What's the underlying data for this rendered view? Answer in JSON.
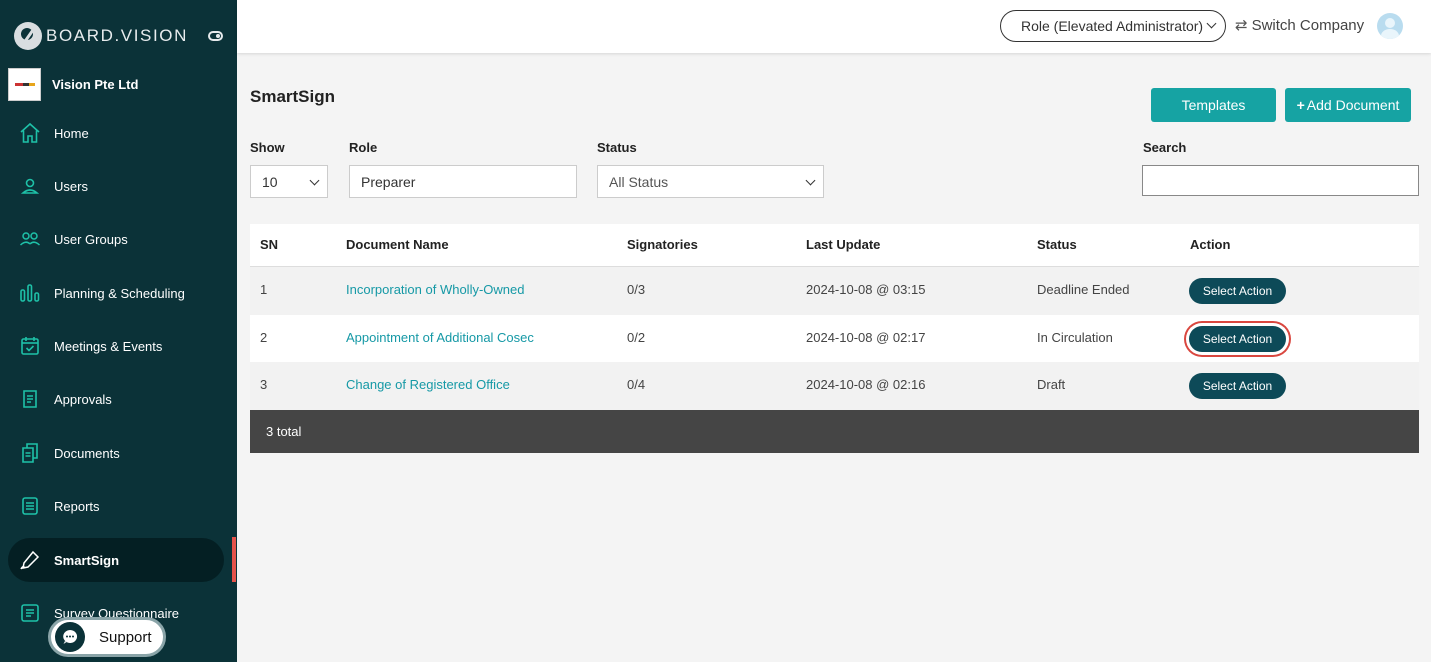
{
  "brand": {
    "name": "BOARD.VISION"
  },
  "company": {
    "name": "Vision Pte Ltd"
  },
  "sidebar": {
    "items": [
      {
        "label": "Home",
        "icon": "home-icon"
      },
      {
        "label": "Users",
        "icon": "user-icon"
      },
      {
        "label": "User Groups",
        "icon": "user-group-icon"
      },
      {
        "label": "Planning & Scheduling",
        "icon": "bar-chart-icon"
      },
      {
        "label": "Meetings & Events",
        "icon": "calendar-icon"
      },
      {
        "label": "Approvals",
        "icon": "approval-icon"
      },
      {
        "label": "Documents",
        "icon": "documents-icon"
      },
      {
        "label": "Reports",
        "icon": "report-icon"
      },
      {
        "label": "SmartSign",
        "icon": "pen-icon",
        "active": true
      },
      {
        "label": "Survey Questionnaire",
        "icon": "survey-icon"
      }
    ],
    "support_label": "Support"
  },
  "topbar": {
    "role": "Role (Elevated Administrator)",
    "switch_company": "Switch Company"
  },
  "page": {
    "title": "SmartSign",
    "templates_label": "Templates",
    "add_document_label": "Add Document"
  },
  "filters": {
    "show_label": "Show",
    "show_value": "10",
    "role_label": "Role",
    "role_value": "Preparer",
    "status_label": "Status",
    "status_value": "All Status",
    "search_label": "Search",
    "search_value": ""
  },
  "table": {
    "headers": {
      "sn": "SN",
      "document_name": "Document Name",
      "signatories": "Signatories",
      "last_update": "Last Update",
      "status": "Status",
      "action": "Action"
    },
    "rows": [
      {
        "sn": "1",
        "document_name": "Incorporation of Wholly-Owned",
        "signatories": "0/3",
        "last_update": "2024-10-08 @ 03:15",
        "status": "Deadline Ended",
        "action": "Select Action"
      },
      {
        "sn": "2",
        "document_name": "Appointment of Additional Cosec",
        "signatories": "0/2",
        "last_update": "2024-10-08 @ 02:17",
        "status": "In Circulation",
        "action": "Select Action"
      },
      {
        "sn": "3",
        "document_name": "Change of Registered Office",
        "signatories": "0/4",
        "last_update": "2024-10-08 @ 02:16",
        "status": "Draft",
        "action": "Select Action"
      }
    ],
    "footer": "3 total"
  },
  "colors": {
    "sidebar_bg": "#0b3238",
    "accent_teal": "#16a3a3",
    "action_button": "#0d4a58",
    "link": "#1699a6",
    "highlight": "#d9473f"
  }
}
